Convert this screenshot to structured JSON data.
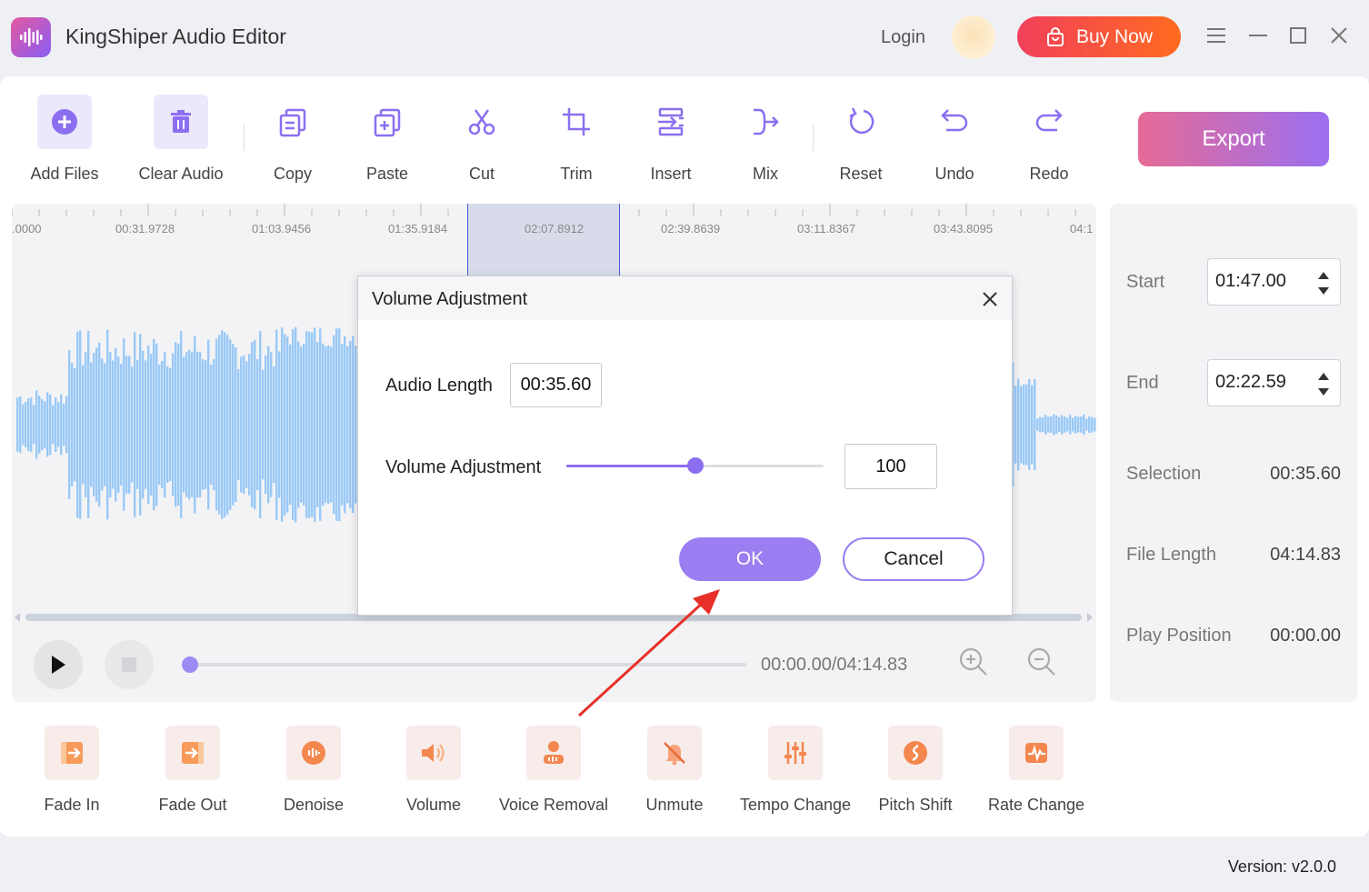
{
  "app": {
    "title": "KingShiper Audio Editor",
    "login_label": "Login",
    "buy_label": "Buy Now",
    "version": "Version: v2.0.0"
  },
  "toolbar": {
    "items": [
      {
        "label": "Add Files",
        "icon": "add-files-icon"
      },
      {
        "label": "Clear Audio",
        "icon": "trash-icon"
      },
      {
        "label": "Copy",
        "icon": "copy-icon"
      },
      {
        "label": "Paste",
        "icon": "paste-icon"
      },
      {
        "label": "Cut",
        "icon": "scissors-icon"
      },
      {
        "label": "Trim",
        "icon": "crop-icon"
      },
      {
        "label": "Insert",
        "icon": "insert-icon"
      },
      {
        "label": "Mix",
        "icon": "mix-icon"
      },
      {
        "label": "Reset",
        "icon": "reset-icon"
      },
      {
        "label": "Undo",
        "icon": "undo-icon"
      },
      {
        "label": "Redo",
        "icon": "redo-icon"
      }
    ],
    "export_label": "Export"
  },
  "timeline": {
    "ticks": [
      ".0000",
      "00:31.9728",
      "01:03.9456",
      "01:35.9184",
      "02:07.8912",
      "02:39.8639",
      "03:11.8367",
      "03:43.8095",
      "04:1"
    ],
    "playback_progress": 0.0,
    "time_readout": "00:00.00/04:14.83"
  },
  "info": {
    "start_label": "Start",
    "start_value": "01:47.00",
    "end_label": "End",
    "end_value": "02:22.59",
    "selection_label": "Selection",
    "selection_value": "00:35.60",
    "file_length_label": "File Length",
    "file_length_value": "04:14.83",
    "play_position_label": "Play Position",
    "play_position_value": "00:00.00"
  },
  "effects": [
    {
      "label": "Fade In",
      "icon": "fade-in-icon"
    },
    {
      "label": "Fade Out",
      "icon": "fade-out-icon"
    },
    {
      "label": "Denoise",
      "icon": "denoise-icon"
    },
    {
      "label": "Volume",
      "icon": "volume-icon"
    },
    {
      "label": "Voice Removal",
      "icon": "voice-removal-icon"
    },
    {
      "label": "Unmute",
      "icon": "unmute-icon"
    },
    {
      "label": "Tempo Change",
      "icon": "tempo-change-icon"
    },
    {
      "label": "Pitch Shift",
      "icon": "pitch-shift-icon"
    },
    {
      "label": "Rate Change",
      "icon": "rate-change-icon"
    }
  ],
  "dialog": {
    "title": "Volume Adjustment",
    "audio_length_label": "Audio Length",
    "audio_length_value": "00:35.60",
    "volume_label": "Volume Adjustment",
    "volume_value": "100",
    "volume_slider_fraction": 0.5,
    "ok_label": "OK",
    "cancel_label": "Cancel"
  },
  "colors": {
    "accent": "#8b6ff0",
    "buy_gradient_start": "#f1405b",
    "buy_gradient_end": "#ff6a20",
    "waveform": "#99c9f7",
    "annotation_arrow": "#e8302a"
  }
}
